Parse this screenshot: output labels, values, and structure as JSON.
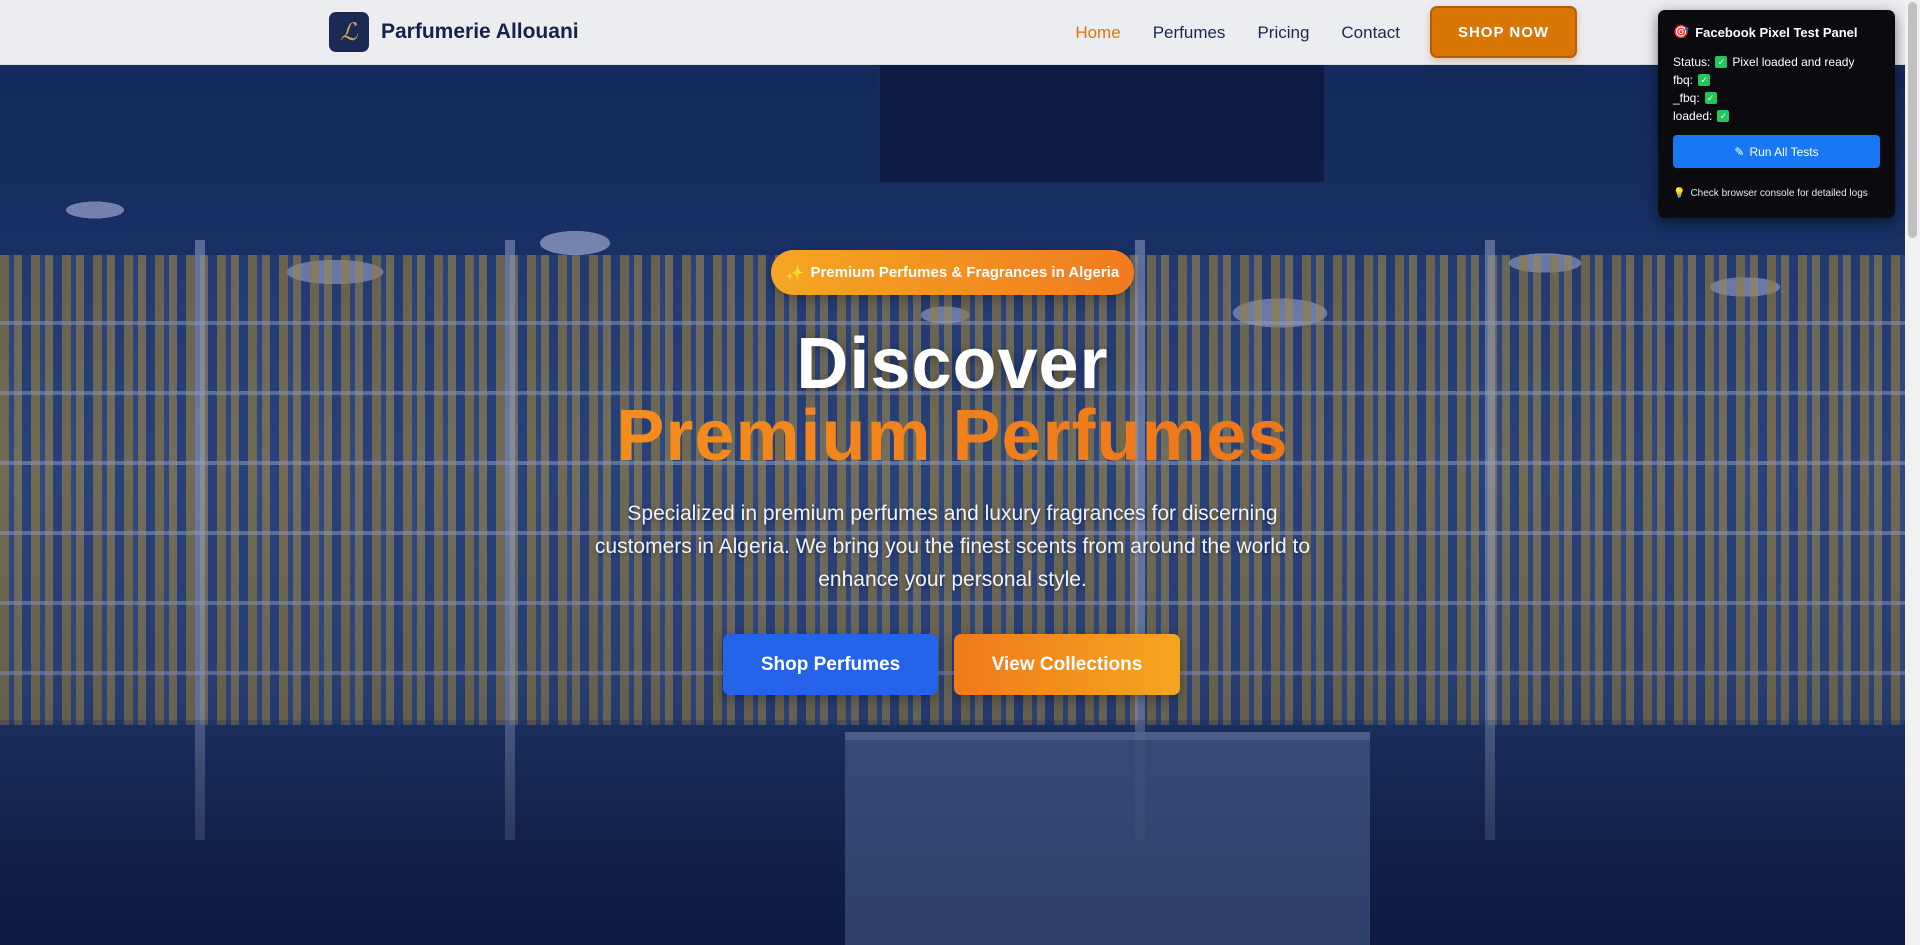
{
  "header": {
    "brand_logo": "ℒ",
    "brand_name": "Parfumerie Allouani",
    "nav": [
      {
        "label": "Home",
        "active": true
      },
      {
        "label": "Perfumes",
        "active": false
      },
      {
        "label": "Pricing",
        "active": false
      },
      {
        "label": "Contact",
        "active": false
      }
    ],
    "shop_now_label": "SHOP NOW"
  },
  "hero": {
    "badge_icon": "✨",
    "badge_text": "Premium Perfumes & Fragrances in Algeria",
    "headline_line1": "Discover",
    "headline_line2": "Premium Perfumes",
    "subtitle": "Specialized in premium perfumes and luxury fragrances for discerning customers in Algeria. We bring you the finest scents from around the world to enhance your personal style.",
    "primary_cta": "Shop Perfumes",
    "secondary_cta": "View Collections"
  },
  "pixel_panel": {
    "title_icon": "🎯",
    "title": "Facebook Pixel Test Panel",
    "rows": [
      {
        "label": "Status:",
        "check": "✓",
        "value": "Pixel loaded and ready"
      },
      {
        "label": "fbq:",
        "check": "✓",
        "value": ""
      },
      {
        "label": "_fbq:",
        "check": "✓",
        "value": ""
      },
      {
        "label": "loaded:",
        "check": "✓",
        "value": ""
      }
    ],
    "run_icon": "✎",
    "run_button": "Run All Tests",
    "hint_icon": "💡",
    "hint": "Check browser console for detailed logs",
    "ghost_text": "ready"
  },
  "colors": {
    "accent_orange": "#d97706",
    "primary_blue": "#2563eb",
    "brand_navy": "#17224a",
    "panel_button": "#1877f2"
  }
}
